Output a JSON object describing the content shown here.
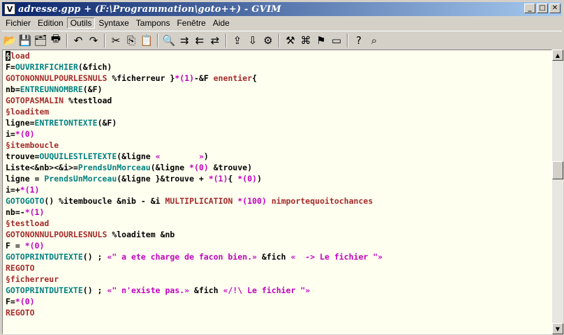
{
  "window": {
    "title": "adresse.gpp + (F:\\Programmation\\goto++) - GVIM",
    "icon_glyph": "V"
  },
  "title_buttons": {
    "minimize": "_",
    "maximize": "□",
    "close": "✕"
  },
  "menu": [
    {
      "label": "Fichier"
    },
    {
      "label": "Edition"
    },
    {
      "label": "Outils"
    },
    {
      "label": "Syntaxe"
    },
    {
      "label": "Tampons"
    },
    {
      "label": "Fenêtre"
    },
    {
      "label": "Aide"
    }
  ],
  "toolbar": {
    "icons": [
      "open-icon",
      "save-icon",
      "save-all-icon",
      "print-icon",
      "undo-icon",
      "redo-icon",
      "cut-icon",
      "copy-icon",
      "paste-icon",
      "find-icon",
      "find-next-icon",
      "find-prev-icon",
      "replace-icon",
      "load-session-icon",
      "save-session-icon",
      "run-script-icon",
      "make-icon",
      "shell-icon",
      "tags-icon",
      "jump-tag-icon",
      "help-icon",
      "find-help-icon"
    ]
  },
  "editor": {
    "lines": [
      [
        {
          "t": "§",
          "c": "cursor"
        },
        {
          "t": "load",
          "c": "lbl"
        }
      ],
      [
        {
          "t": "F=",
          "c": ""
        },
        {
          "t": "OUVRIRFICHIER",
          "c": "fn"
        },
        {
          "t": "(&fich)",
          "c": ""
        }
      ],
      [
        {
          "t": "GOTONONNULPOURLESNULS",
          "c": "kw"
        },
        {
          "t": " %ficherreur }",
          "c": ""
        },
        {
          "t": "*(1)",
          "c": "num"
        },
        {
          "t": "-&F ",
          "c": ""
        },
        {
          "t": "enentier",
          "c": "kw"
        },
        {
          "t": "{",
          "c": ""
        }
      ],
      [
        {
          "t": "nb=",
          "c": ""
        },
        {
          "t": "ENTREUNNOMBRE",
          "c": "fn"
        },
        {
          "t": "(&F)",
          "c": ""
        }
      ],
      [
        {
          "t": "GOTOPASMALIN",
          "c": "kw"
        },
        {
          "t": " %testload",
          "c": ""
        }
      ],
      [
        {
          "t": "§loaditem",
          "c": "lbl"
        }
      ],
      [
        {
          "t": "ligne=",
          "c": ""
        },
        {
          "t": "ENTRETONTEXTE",
          "c": "fn"
        },
        {
          "t": "(&F)",
          "c": ""
        }
      ],
      [
        {
          "t": "i=",
          "c": ""
        },
        {
          "t": "*(0)",
          "c": "num"
        }
      ],
      [
        {
          "t": "§itemboucle",
          "c": "lbl"
        }
      ],
      [
        {
          "t": "trouve=",
          "c": ""
        },
        {
          "t": "OUQUILESTLETEXTE",
          "c": "fn"
        },
        {
          "t": "(&ligne ",
          "c": ""
        },
        {
          "t": "«        »",
          "c": "str"
        },
        {
          "t": ")",
          "c": ""
        }
      ],
      [
        {
          "t": "Liste<&nb><&i>=",
          "c": ""
        },
        {
          "t": "PrendsUnMorceau",
          "c": "fn"
        },
        {
          "t": "(&ligne ",
          "c": ""
        },
        {
          "t": "*(0)",
          "c": "num"
        },
        {
          "t": " &trouve)",
          "c": ""
        }
      ],
      [
        {
          "t": "ligne = ",
          "c": ""
        },
        {
          "t": "PrendsUnMorceau",
          "c": "fn"
        },
        {
          "t": "(&ligne }&trouve + ",
          "c": ""
        },
        {
          "t": "*(1)",
          "c": "num"
        },
        {
          "t": "{ ",
          "c": ""
        },
        {
          "t": "*(0)",
          "c": "num"
        },
        {
          "t": ")",
          "c": ""
        }
      ],
      [
        {
          "t": "i=+",
          "c": ""
        },
        {
          "t": "*(1)",
          "c": "num"
        }
      ],
      [
        {
          "t": "GOTOGOTO",
          "c": "fn"
        },
        {
          "t": "() %itemboucle &nib - &i ",
          "c": ""
        },
        {
          "t": "MULTIPLICATION",
          "c": "kw"
        },
        {
          "t": " ",
          "c": ""
        },
        {
          "t": "*(100)",
          "c": "num"
        },
        {
          "t": " ",
          "c": ""
        },
        {
          "t": "nimportequoitochances",
          "c": "kw"
        }
      ],
      [
        {
          "t": "nb=-",
          "c": ""
        },
        {
          "t": "*(1)",
          "c": "num"
        }
      ],
      [
        {
          "t": "§testload",
          "c": "lbl"
        }
      ],
      [
        {
          "t": "GOTONONNULPOURLESNULS",
          "c": "kw"
        },
        {
          "t": " %loaditem &nb",
          "c": ""
        }
      ],
      [
        {
          "t": "F = ",
          "c": ""
        },
        {
          "t": "*(0)",
          "c": "num"
        }
      ],
      [
        {
          "t": "GOTOPRINTDUTEXTE",
          "c": "fn"
        },
        {
          "t": "() ; ",
          "c": ""
        },
        {
          "t": "«\" a ete charge de facon bien.»",
          "c": "str"
        },
        {
          "t": " &fich ",
          "c": ""
        },
        {
          "t": "«  -> Le fichier \"»",
          "c": "str"
        }
      ],
      [
        {
          "t": "REGOTO",
          "c": "kw"
        }
      ],
      [
        {
          "t": "§ficherreur",
          "c": "lbl"
        }
      ],
      [
        {
          "t": "GOTOPRINTDUTEXTE",
          "c": "fn"
        },
        {
          "t": "() ; ",
          "c": ""
        },
        {
          "t": "«\" n'existe pas.»",
          "c": "str"
        },
        {
          "t": " &fich ",
          "c": ""
        },
        {
          "t": "«/!\\ Le fichier \"»",
          "c": "str"
        }
      ],
      [
        {
          "t": "F=",
          "c": ""
        },
        {
          "t": "*(0)",
          "c": "num"
        }
      ],
      [
        {
          "t": "REGOTO",
          "c": "kw"
        }
      ]
    ]
  },
  "scrollbar": {
    "up": "▲",
    "down": "▼"
  },
  "colors": {
    "editor_bg": "#fffff0",
    "label": "#a52a2a",
    "function": "#008080",
    "number": "#c000c0"
  }
}
